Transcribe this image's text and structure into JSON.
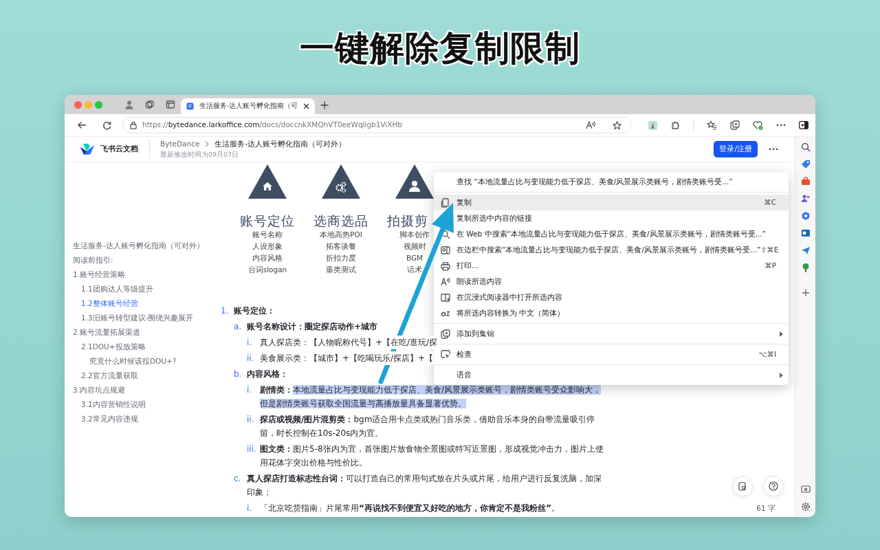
{
  "headline": "一键解除复制限制",
  "browser": {
    "tabs": [
      {
        "title": "生活服务-达人账号孵化指南（可",
        "selected": true
      }
    ],
    "address": {
      "scheme": "https://",
      "host": "bytedance.larkoffice.com",
      "path": "/docs/doccnkXMQhVT0eeWqligb1ViXHb"
    }
  },
  "doc_header": {
    "app_name": "飞书云文档",
    "breadcrumb": [
      {
        "label": "ByteDance"
      },
      {
        "label": "生活服务-达人账号孵化指南（可对外）"
      }
    ],
    "modified": "最新修改时间为09月07日",
    "login_button": "登录/注册"
  },
  "outline": [
    {
      "text": "生活服务-达人账号孵化指南（可对外）",
      "selected": false
    },
    {
      "text": "阅读前指引:",
      "selected": false
    },
    {
      "text": "1.账号经营策略",
      "selected": false,
      "children": [
        {
          "text": "1.1团购达人等级提升",
          "selected": false
        },
        {
          "text": "1.2整体账号经营",
          "selected": true
        },
        {
          "text": "1.3旧账号转型建议-围绕兴趣展开",
          "selected": false
        }
      ]
    },
    {
      "text": "2.账号流量拓展渠道",
      "selected": false,
      "children": [
        {
          "text": "2.1DOU+投放策略",
          "selected": false,
          "children": [
            {
              "text": "究竟什么时候该投DOU+?",
              "selected": false
            }
          ]
        },
        {
          "text": "2.2官方流量获取",
          "selected": false
        }
      ]
    },
    {
      "text": "3.内容坑点规避",
      "selected": false,
      "children": [
        {
          "text": "3.1内容营销性说明",
          "selected": false
        },
        {
          "text": "3.2常见内容违规",
          "selected": false
        }
      ]
    }
  ],
  "diagram": [
    {
      "title": "账号定位",
      "items": [
        "账号名称",
        "人设形象",
        "内容风格",
        "台词slogan"
      ]
    },
    {
      "title": "选商选品",
      "items": [
        "本地高热POI",
        "拓客谈餐",
        "折扣力度",
        "垂类测试"
      ]
    },
    {
      "title": "拍摄剪",
      "items": [
        "脚本创作",
        "视频时",
        "BGM",
        "话术"
      ]
    }
  ],
  "document": [
    {
      "marker": "1.",
      "label": "账号定位：",
      "children": [
        {
          "marker": "a.",
          "label": "账号名称设计：圈定探店动作+城市",
          "children": [
            {
              "marker": "i.",
              "text": "真人探店类：【人物昵称代号】+【在吃/逛玩/探"
            },
            {
              "marker": "ii.",
              "text": "美食展示类：【城市】+【吃喝玩乐/探店】+【"
            }
          ]
        },
        {
          "marker": "b.",
          "label": "内容风格：",
          "children": [
            {
              "marker": "i.",
              "label": "剧情类：",
              "text": "本地流量占比与变现能力低于探店、美食/风景展示类账号，剧情类账号受众影响大，但是剧情类账号获取全国流量与高播放量具备显著优势。",
              "highlighted": true
            },
            {
              "marker": "ii.",
              "label": "探店或视频/图片混剪类：",
              "text": "bgm适合用卡点类或热门音乐类，借助音乐本身的自带流量吸引停留，时长控制在10s-20s内为宜。",
              "highlighted": false
            },
            {
              "marker": "iii.",
              "label": "图文类：",
              "text": "图片5-8张内为宜，首张图片放食物全景图或特写近景图，形成视觉冲击力，图片上使用花体字突出价格与性价比。",
              "highlighted": false
            }
          ]
        },
        {
          "marker": "c.",
          "label": "真人探店打造标志性台词：",
          "text": "可以打造自己的常用句式放在片头或片尾，给用户进行反复洗脑，加深印象；",
          "children": [
            {
              "marker": "i.",
              "text": "「北京吃货指南」片尾常用**“再说找不到便宜又好吃的地方，你肯定不是我粉丝”**。"
            }
          ]
        }
      ]
    }
  ],
  "context_menu": {
    "groups": [
      [
        {
          "label": "查找 “本地流量占比与变现能力低于探店、美食/风景展示类账号，剧情类账号受...”",
          "selected": false,
          "has_submenu": false
        }
      ],
      [
        {
          "label": "复制",
          "shortcut": "⌘C",
          "selected": true,
          "has_submenu": false
        },
        {
          "label": "复制所选中内容的链接",
          "selected": false,
          "has_submenu": false
        },
        {
          "label": "在 Web 中搜索“本地流量占比与变现能力低于探店、美食/风景展示类账号，剧情类账号受...”",
          "selected": false,
          "has_submenu": false
        },
        {
          "label": "在边栏中搜索“本地流量占比与变现能力低于探店、美食/风景展示类账号，剧情类账号受...”",
          "shortcut": "⇧⌘E",
          "selected": false,
          "has_submenu": false
        },
        {
          "label": "打印...",
          "shortcut": "⌘P",
          "selected": false,
          "has_submenu": false
        },
        {
          "label": "朗读所选内容",
          "selected": false,
          "has_submenu": false
        },
        {
          "label": "在沉浸式阅读器中打开所选内容",
          "selected": false,
          "has_submenu": false
        },
        {
          "label": "将所选内容转换为 中文（简体）",
          "selected": false,
          "has_submenu": false
        }
      ],
      [
        {
          "label": "添加到集锦",
          "selected": false,
          "has_submenu": true
        }
      ],
      [
        {
          "label": "检查",
          "shortcut": "⌥⌘I",
          "selected": false,
          "has_submenu": false
        }
      ],
      [
        {
          "label": "语音",
          "selected": false,
          "has_submenu": true
        }
      ]
    ]
  },
  "word_count": "61 字"
}
